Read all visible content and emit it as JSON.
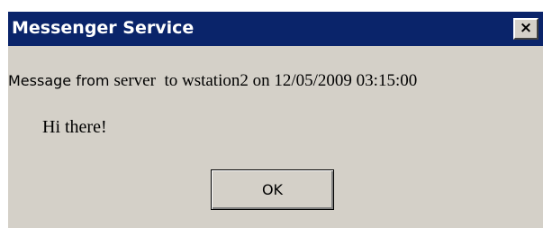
{
  "window": {
    "title": "Messenger Service",
    "close_label": "×"
  },
  "message": {
    "prefix": "Message from ",
    "sender": "server",
    "to": "to",
    "recipient": "wstation2",
    "on": "on",
    "timestamp": "12/05/2009 03:15:00"
  },
  "body": {
    "text": "Hi there!"
  },
  "buttons": {
    "ok_label": "OK"
  },
  "colors": {
    "titlebar": "#0a246a",
    "window_bg": "#d4d0c8"
  }
}
